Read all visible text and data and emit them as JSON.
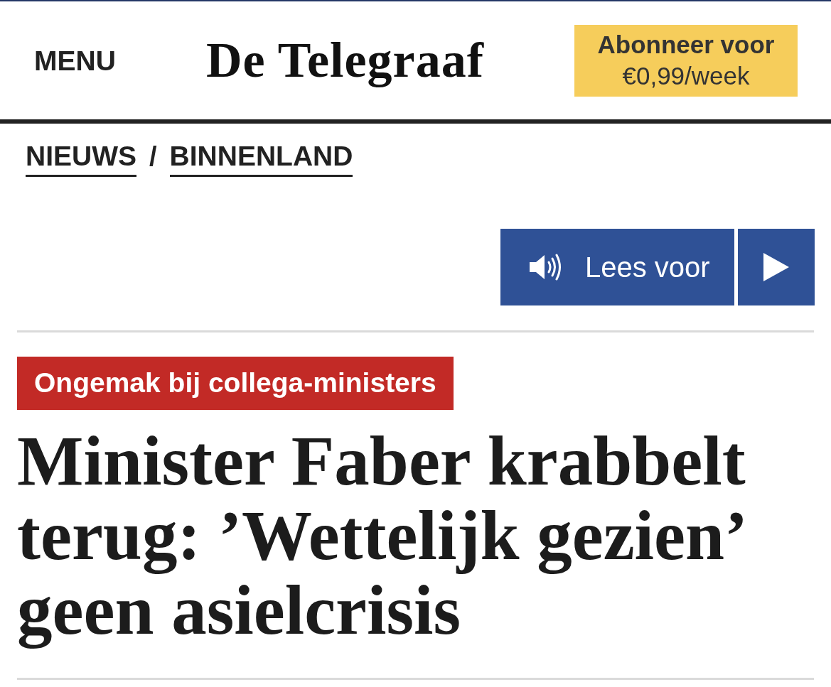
{
  "header": {
    "menu": "MENU",
    "logo": "De Telegraaf",
    "subscribe": {
      "line1": "Abonneer voor",
      "line2": "€0,99/week"
    }
  },
  "breadcrumb": {
    "items": [
      "NIEUWS",
      "BINNENLAND"
    ],
    "separator": "/"
  },
  "read_aloud": {
    "label": "Lees voor"
  },
  "article": {
    "label": "Ongemak bij collega-ministers",
    "headline": "Minister Faber krabbelt terug: ’Wettelijk gezien’ geen asielcrisis"
  }
}
